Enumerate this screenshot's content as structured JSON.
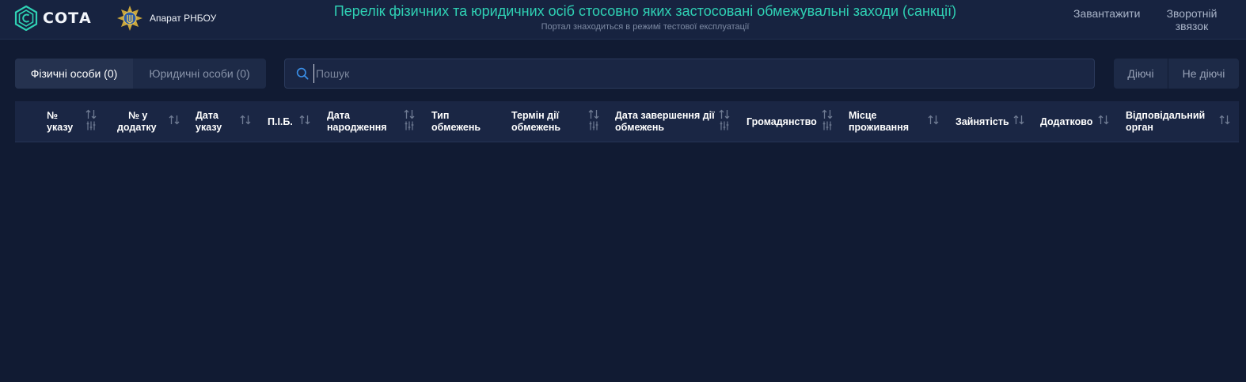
{
  "header": {
    "logo_text": "СОТА",
    "org_name": "Апарат РНБОУ",
    "title": "Перелік фізичних та юридичних осіб стосовно яких застосовані обмежувальні заходи (санкції)",
    "subtitle": "Портал знаходиться в режимі тестової експлуатації",
    "nav": {
      "download": "Завантажити",
      "feedback_line1": "Зворотній",
      "feedback_line2": "звязок"
    }
  },
  "tabs": {
    "individuals": "Фізичні особи (0)",
    "legal": "Юридичні особи (0)"
  },
  "search": {
    "placeholder": "Пошук",
    "value": ""
  },
  "status_filter": {
    "active": "Діючі",
    "inactive": "Не діючі"
  },
  "table": {
    "columns": [
      {
        "line1": "№",
        "line2": "указу"
      },
      {
        "line1": "№ у",
        "line2": "додатку"
      },
      {
        "line1": "Дата",
        "line2": "указу"
      },
      {
        "line1": "П.І.Б.",
        "line2": ""
      },
      {
        "line1": "Дата",
        "line2": "народження"
      },
      {
        "line1": "Тип",
        "line2": "обмежень"
      },
      {
        "line1": "Термін дії",
        "line2": "обмежень"
      },
      {
        "line1": "Дата завершення дії",
        "line2": "обмежень"
      },
      {
        "line1": "Громадянство",
        "line2": ""
      },
      {
        "line1": "Місце",
        "line2": "проживання"
      },
      {
        "line1": "Зайнятість",
        "line2": ""
      },
      {
        "line1": "Додатково",
        "line2": ""
      },
      {
        "line1": "Відповідальний",
        "line2": "орган"
      }
    ],
    "rows": []
  },
  "colors": {
    "accent": "#2fd1b4",
    "search_icon": "#3a8fe8",
    "background": "#111b33"
  }
}
